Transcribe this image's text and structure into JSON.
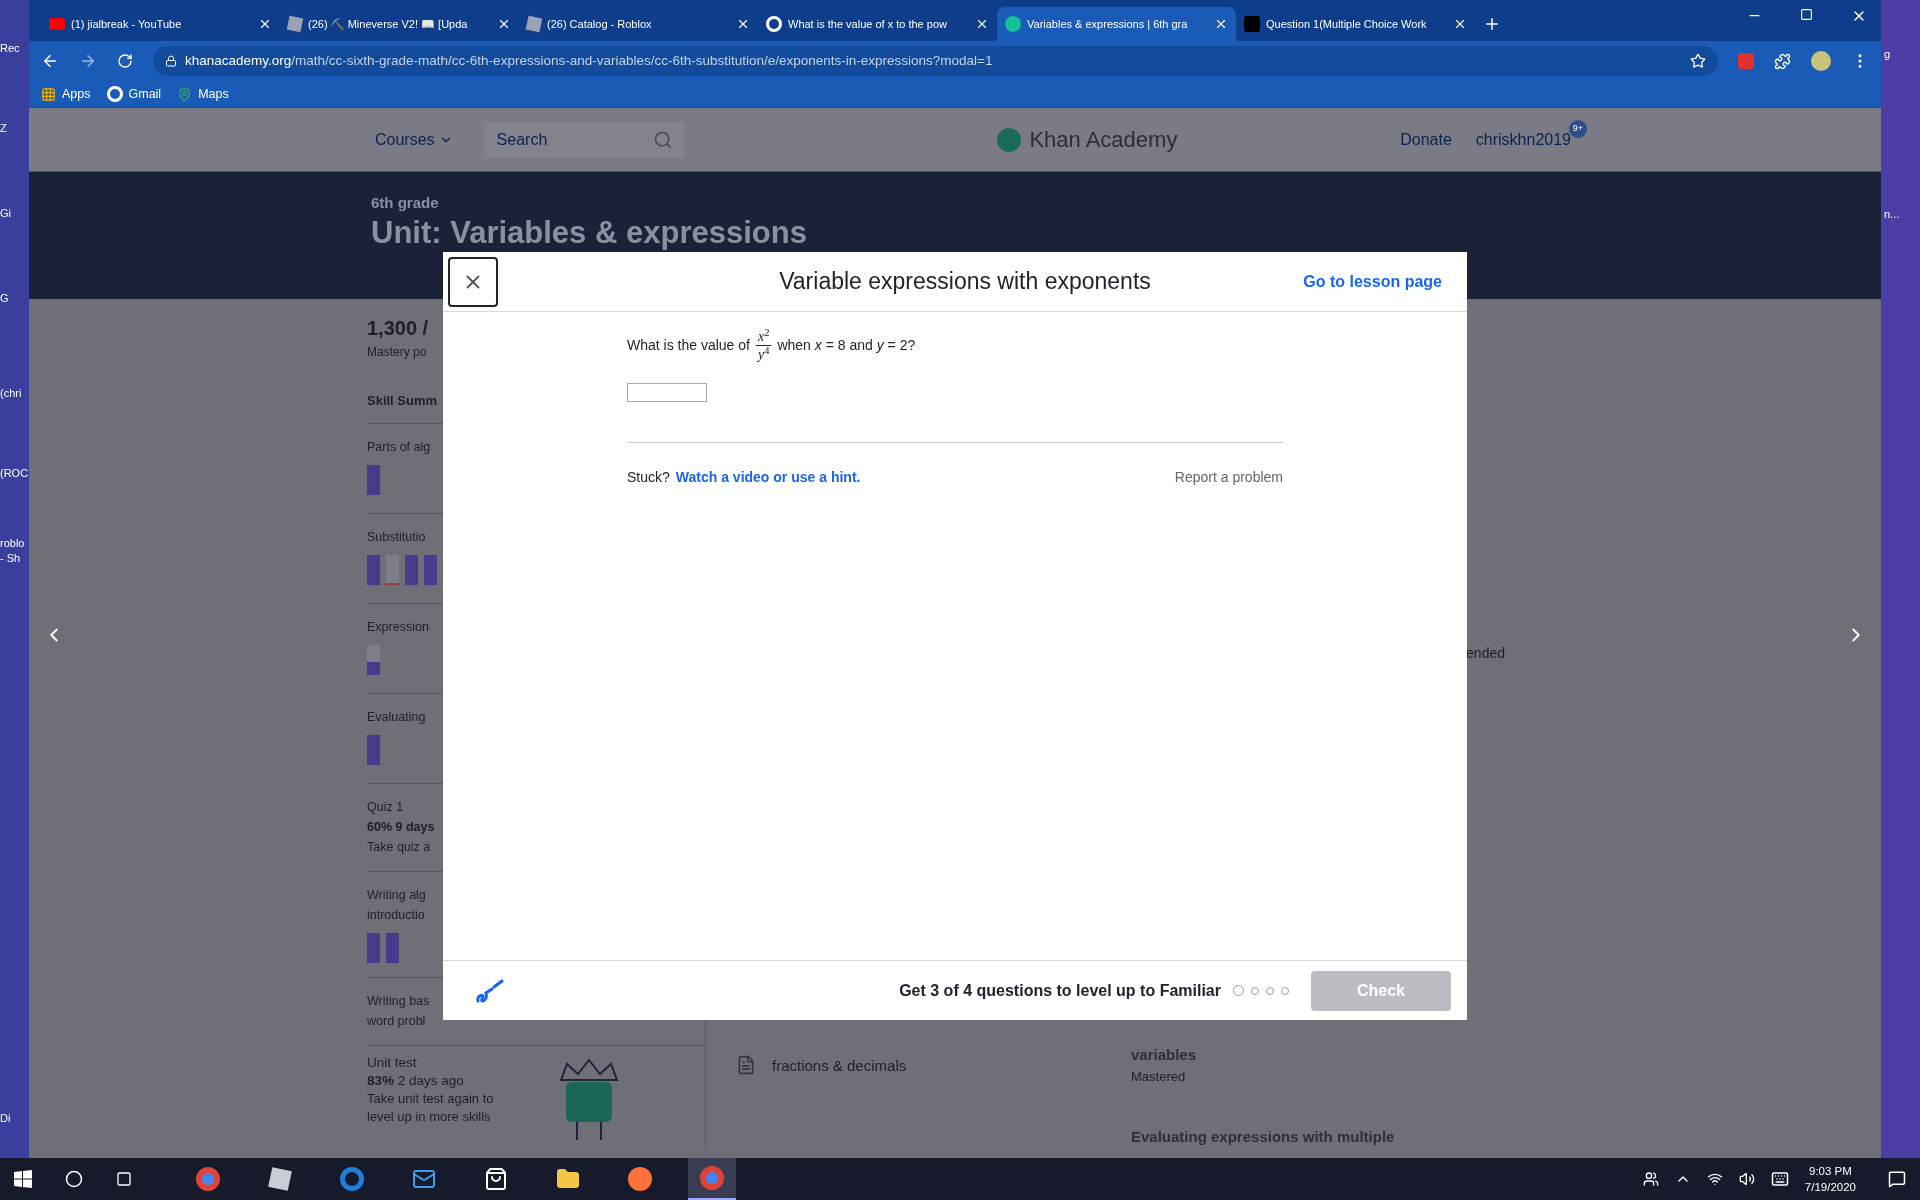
{
  "desktop": {
    "left_labels": [
      "Rec",
      "Z",
      "Gi",
      "G",
      "(chri",
      "(ROC",
      "roblo",
      "- Sh",
      "Di"
    ],
    "right_labels": [
      "g",
      "n..."
    ]
  },
  "browser": {
    "tabs": [
      {
        "title": "(1) jialbreak - YouTube",
        "kind": "youtube",
        "selected": false
      },
      {
        "title": "(26) ⛏️ Mineverse V2! 📖 [Upda",
        "kind": "roblox",
        "selected": false
      },
      {
        "title": "(26) Catalog - Roblox",
        "kind": "roblox",
        "selected": false
      },
      {
        "title": "What is the value of x to the pow",
        "kind": "google",
        "selected": false
      },
      {
        "title": "Variables & expressions | 6th gra",
        "kind": "khan",
        "selected": true
      },
      {
        "title": "Question 1(Multiple Choice Work",
        "kind": "brainly",
        "selected": false
      }
    ],
    "url_host": "khanacademy.org",
    "url_path": "/math/cc-sixth-grade-math/cc-6th-expressions-and-variables/cc-6th-substitution/e/exponents-in-expressions?modal=1",
    "bookmarks": [
      {
        "label": "Apps",
        "kind": "apps"
      },
      {
        "label": "Gmail",
        "kind": "google"
      },
      {
        "label": "Maps",
        "kind": "maps"
      }
    ]
  },
  "page": {
    "header": {
      "courses": "Courses",
      "search_placeholder": "Search",
      "logo": "Khan Academy",
      "donate": "Donate",
      "username": "chriskhn2019",
      "badge": "9+"
    },
    "banner": {
      "grade": "6th grade",
      "title": "Unit: Variables & expressions"
    },
    "points": "1,300 /",
    "points_label": "Mastery po",
    "summary_title": "Skill Summ",
    "skills": [
      {
        "lines": [
          "Parts of alg"
        ],
        "bars": [
          {
            "kind": "mastered"
          }
        ]
      },
      {
        "lines": [
          "Substitutio"
        ],
        "bars": [
          {
            "kind": "mastered"
          },
          {
            "kind": "attempted"
          },
          {
            "kind": "mastered"
          },
          {
            "kind": "mastered"
          }
        ]
      },
      {
        "lines": [
          "Expression"
        ],
        "bars": [
          {
            "kind": "familiar"
          }
        ]
      },
      {
        "lines": [
          "Evaluating"
        ],
        "bars": [
          {
            "kind": "mastered"
          }
        ]
      },
      {
        "lines": [
          "Quiz 1",
          "60% 9 days",
          "Take quiz a"
        ]
      },
      {
        "lines": [
          "Writing alg",
          "introductio"
        ],
        "bars": [
          {
            "kind": "mastered"
          },
          {
            "kind": "mastered"
          }
        ]
      },
      {
        "lines": [
          "Writing bas",
          "word probl"
        ]
      }
    ],
    "unit_test": {
      "title": "Unit test",
      "score": "83%",
      "when": "2 days ago",
      "hint": "Take unit test again to level up in more skills"
    },
    "recommended_fragment": "ended",
    "middle_card": "fractions & decimals",
    "right_cards": [
      {
        "title": "variables",
        "status": "Mastered"
      },
      {
        "title": "Evaluating expressions with multiple"
      }
    ]
  },
  "modal": {
    "title": "Variable expressions with exponents",
    "lesson_link": "Go to lesson page",
    "question": {
      "before": "What is the value of",
      "numerator": "*x*$^{2}$",
      "denominator": "*y*$^{4}$",
      "after": "when *x* = 8 and *y* = 2?"
    },
    "stuck": "Stuck?",
    "hint_link": "Watch a video or use a hint.",
    "report": "Report a problem",
    "progress_text": "Get 3 of 4 questions to level up to Familiar",
    "progress": [
      {
        "current": true
      },
      {
        "current": false
      },
      {
        "current": false
      },
      {
        "current": false
      }
    ],
    "check": {
      "label": "Check",
      "disabled": true
    }
  },
  "taskbar": {
    "apps": [
      {
        "kind": "chrome",
        "selected": false
      },
      {
        "kind": "roblox",
        "selected": false
      },
      {
        "kind": "edge",
        "selected": false
      },
      {
        "kind": "mail",
        "selected": false
      },
      {
        "kind": "store",
        "selected": false
      },
      {
        "kind": "folder",
        "selected": false
      },
      {
        "kind": "firefox",
        "selected": false
      },
      {
        "kind": "chrome",
        "selected": true
      }
    ],
    "time": "9:03 PM",
    "date": "7/19/2020"
  }
}
